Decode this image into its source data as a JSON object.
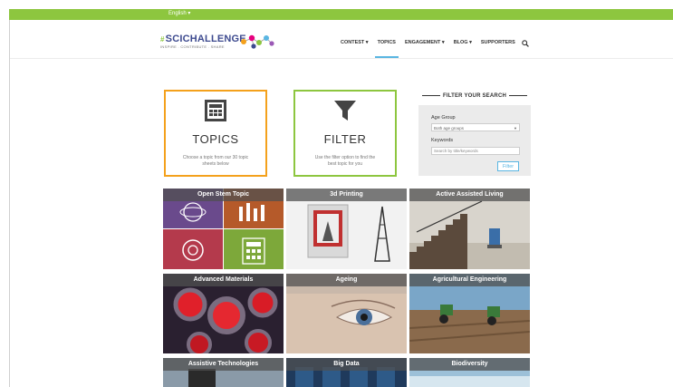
{
  "topbar": {
    "language": "English ▾",
    "accent": "#8dc63f"
  },
  "logo": {
    "hash": "#",
    "title": "SCICHALLENGE",
    "tagline": "INSPIRE . CONTRIBUTE . SHARE"
  },
  "nav": [
    {
      "label": "CONTEST ▾",
      "active": false
    },
    {
      "label": "TOPICS",
      "active": true
    },
    {
      "label": "ENGAGEMENT ▾",
      "active": false
    },
    {
      "label": "BLOG ▾",
      "active": false
    },
    {
      "label": "SUPPORTERS",
      "active": false
    }
  ],
  "icons": {
    "search": "search-icon",
    "topics": "topics-icon",
    "filter": "filter-funnel-icon"
  },
  "topics_box": {
    "title": "TOPICS",
    "text": "Choose a topic from our 30 topic sheets below"
  },
  "filter_box": {
    "title": "FILTER",
    "text": "Use the filter option to find the best topic for you"
  },
  "filter_panel": {
    "heading": "FILTER YOUR SEARCH",
    "age_label": "Age Group",
    "age_value": "Both age groups",
    "keywords_label": "Keywords",
    "keywords_placeholder": "Search by title/keywords",
    "button": "Filter"
  },
  "tiles": [
    {
      "label": "Open Stem Topic"
    },
    {
      "label": "3d Printing"
    },
    {
      "label": "Active Assisted Living"
    },
    {
      "label": "Advanced Materials"
    },
    {
      "label": "Ageing"
    },
    {
      "label": "Agricultural Engineering"
    },
    {
      "label": "Assistive Technologies"
    },
    {
      "label": "Big Data"
    },
    {
      "label": "Biodiversity"
    }
  ]
}
